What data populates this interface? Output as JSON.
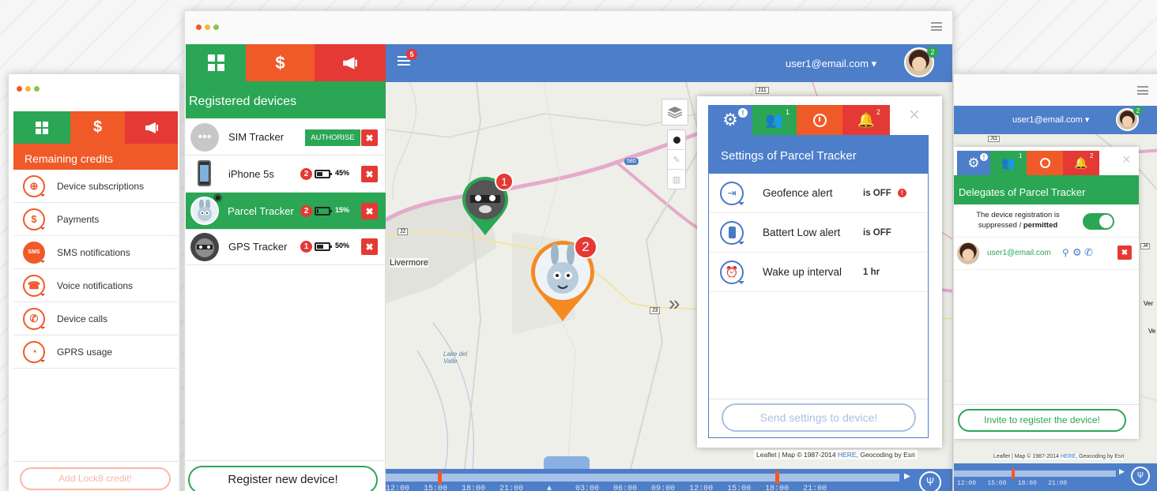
{
  "credits_window": {
    "title": "Remaining credits",
    "tab_dollar": "$",
    "items": [
      {
        "label": "Device subscriptions",
        "icon": "sitemap-icon"
      },
      {
        "label": "Payments",
        "icon": "dollar-icon"
      },
      {
        "label": "SMS notifications",
        "icon": "sms-icon"
      },
      {
        "label": "Voice notifications",
        "icon": "phone-icon"
      },
      {
        "label": "Device calls",
        "icon": "call-icon"
      },
      {
        "label": "GPRS usage",
        "icon": "gauge-icon"
      }
    ],
    "sms_text": "SMS",
    "add_credit_label": "Add Lock8 credit!"
  },
  "devices_window": {
    "tab_dollar": "$",
    "title": "Registered devices",
    "authorise_label": "AUTHORISE",
    "x_label": "✖",
    "devices": [
      {
        "name": "SIM Tracker",
        "badge": "",
        "battery": "",
        "battery_level": 0
      },
      {
        "name": "iPhone 5s",
        "badge": "2",
        "battery": "45%",
        "battery_level": 0.45
      },
      {
        "name": "Parcel Tracker",
        "badge": "2",
        "battery": "15%",
        "battery_level": 0.15
      },
      {
        "name": "GPS Tracker",
        "badge": "1",
        "battery": "50%",
        "battery_level": 0.5
      }
    ],
    "register_label": "Register new device!"
  },
  "main_header": {
    "menu_badge": "5",
    "user": "user1@email.com ▾",
    "avatar_badge": "2"
  },
  "map": {
    "place_livermore": "Livermore",
    "place_lake": "Lake del Valle",
    "road_j11": "J11",
    "road_580": "580",
    "road_j2": "J2",
    "road_j3": "J3",
    "marker1_badge": "1",
    "marker2_badge": "2",
    "attribution_prefix": "Leaflet | Map © 1987-2014 ",
    "attribution_link": "HERE",
    "attribution_suffix": ", Geocoding by Esri"
  },
  "settings_panel": {
    "title": "Settings of Parcel Tracker",
    "tab_delegates_badge": "1",
    "tab_alerts_badge": "2",
    "tab_settings_badge": "!",
    "close": "×",
    "rows": [
      {
        "label": "Geofence alert",
        "value": "is OFF",
        "warn": "!"
      },
      {
        "label": "Battert Low alert",
        "value": "is OFF",
        "warn": ""
      },
      {
        "label": "Wake up interval",
        "value": "1 hr",
        "warn": ""
      }
    ],
    "send_label": "Send settings to device!"
  },
  "timeline": {
    "ticks": "12:00   15:00   18:00   21:00     ▲     03:00   06:00   09:00   12:00   15:00   18:00   21:00",
    "play": "▶",
    "locate": "Ψ"
  },
  "right_window": {
    "user": "user1@email.com ▾",
    "avatar_badge": "2",
    "title": "Delegates of Parcel Tracker",
    "tab_settings_badge": "!",
    "tab_delegates_badge": "1",
    "tab_alerts_badge": "2",
    "close": "×",
    "reg_line1": "The device registration is",
    "reg_line2a": "suppressed / ",
    "reg_line2b": "permitted",
    "delegate_email": "user1@email.com",
    "x_label": "✖",
    "invite_label": "Invite to register the device!",
    "attribution_prefix": "Leaflet | Map © 1987-2014 ",
    "attribution_link": "HERE",
    "attribution_suffix": ", Geocoding by Esri",
    "ticks": "12:00   15:00   18:00   21:00",
    "play": "▶",
    "locate": "Ψ",
    "road_j11": "J11",
    "road_j4": "J4",
    "road_j5": "J5",
    "place_ver1": "Ver",
    "place_ver2": "Ve"
  },
  "colors": {
    "green": "#2aa655",
    "orange": "#f05a28",
    "red": "#e53935",
    "blue": "#4d7ec9"
  }
}
